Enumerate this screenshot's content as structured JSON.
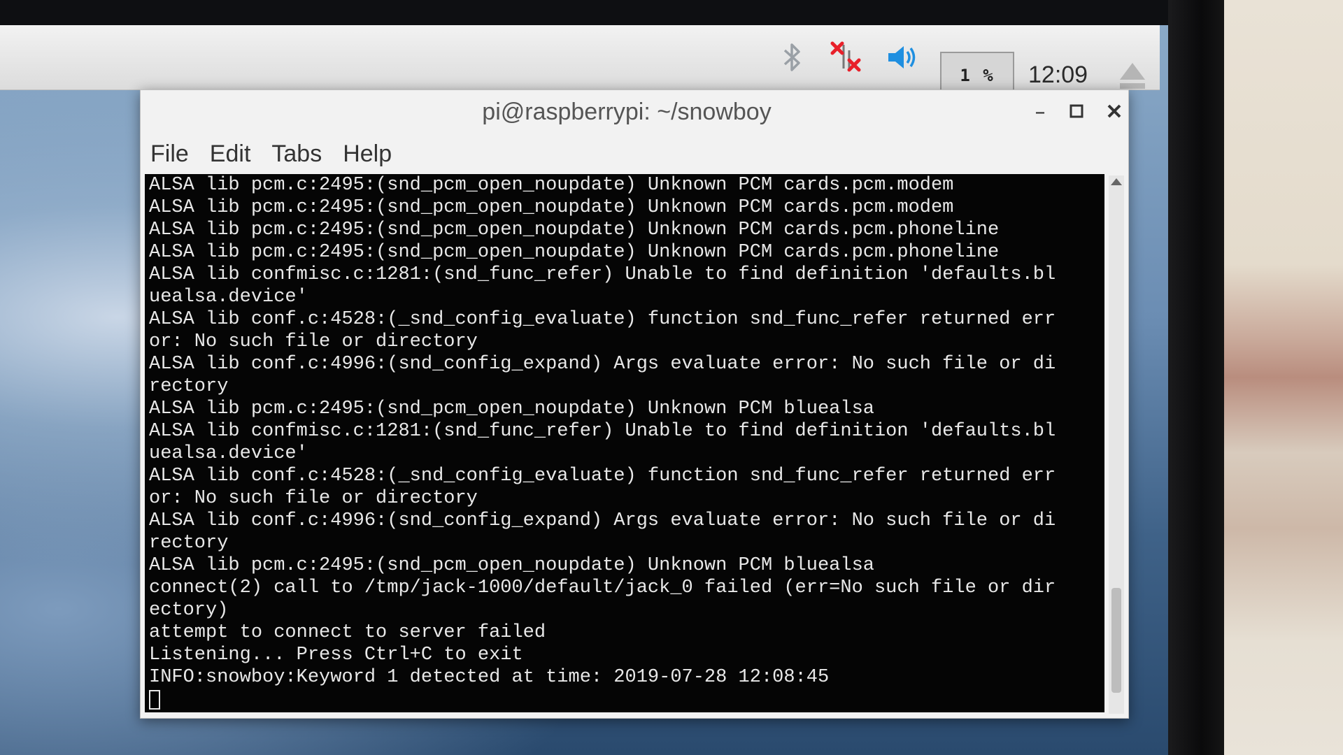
{
  "panel": {
    "cpu_usage": "1 %",
    "clock": "12:09",
    "icons": [
      "bluetooth-icon",
      "network-disconnected-icon",
      "volume-icon",
      "eject-icon"
    ]
  },
  "window": {
    "title": "pi@raspberrypi: ~/snowboy",
    "menu": [
      "File",
      "Edit",
      "Tabs",
      "Help"
    ]
  },
  "terminal": {
    "lines": [
      "ALSA lib pcm.c:2495:(snd_pcm_open_noupdate) Unknown PCM cards.pcm.modem",
      "ALSA lib pcm.c:2495:(snd_pcm_open_noupdate) Unknown PCM cards.pcm.modem",
      "ALSA lib pcm.c:2495:(snd_pcm_open_noupdate) Unknown PCM cards.pcm.phoneline",
      "ALSA lib pcm.c:2495:(snd_pcm_open_noupdate) Unknown PCM cards.pcm.phoneline",
      "ALSA lib confmisc.c:1281:(snd_func_refer) Unable to find definition 'defaults.bl",
      "uealsa.device'",
      "ALSA lib conf.c:4528:(_snd_config_evaluate) function snd_func_refer returned err",
      "or: No such file or directory",
      "ALSA lib conf.c:4996:(snd_config_expand) Args evaluate error: No such file or di",
      "rectory",
      "ALSA lib pcm.c:2495:(snd_pcm_open_noupdate) Unknown PCM bluealsa",
      "ALSA lib confmisc.c:1281:(snd_func_refer) Unable to find definition 'defaults.bl",
      "uealsa.device'",
      "ALSA lib conf.c:4528:(_snd_config_evaluate) function snd_func_refer returned err",
      "or: No such file or directory",
      "ALSA lib conf.c:4996:(snd_config_expand) Args evaluate error: No such file or di",
      "rectory",
      "ALSA lib pcm.c:2495:(snd_pcm_open_noupdate) Unknown PCM bluealsa",
      "connect(2) call to /tmp/jack-1000/default/jack_0 failed (err=No such file or dir",
      "ectory)",
      "attempt to connect to server failed",
      "Listening... Press Ctrl+C to exit",
      "INFO:snowboy:Keyword 1 detected at time: 2019-07-28 12:08:45"
    ]
  }
}
